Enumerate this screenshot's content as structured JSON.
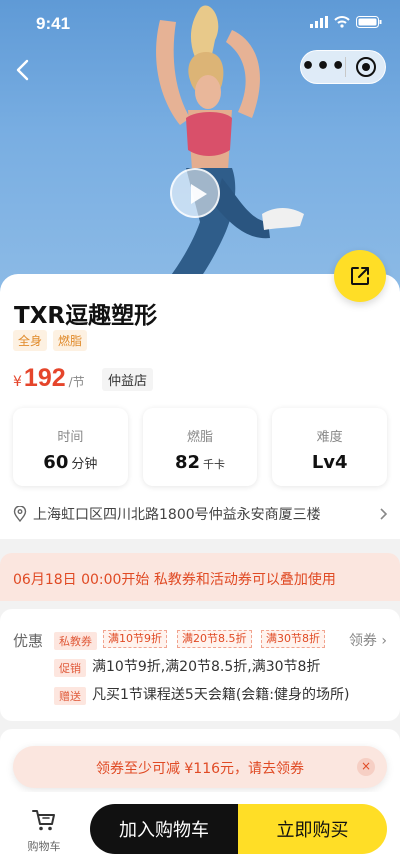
{
  "status_bar": {
    "time": "9:41"
  },
  "product": {
    "title": "TXR逗趣塑形",
    "tags": [
      "全身",
      "燃脂"
    ],
    "price_symbol": "¥",
    "price": "192",
    "price_unit": "/节",
    "store": "仲益店"
  },
  "stats": [
    {
      "label": "时间",
      "value": "60",
      "unit": "分钟"
    },
    {
      "label": "燃脂",
      "value": "82",
      "unit": "千卡"
    },
    {
      "label": "难度",
      "value": "Lv4",
      "unit": ""
    }
  ],
  "address": "上海虹口区四川北路1800号仲益永安商厦三楼",
  "promo_banner": "06月18日 00:00开始 私教券和活动券可以叠加使用",
  "coupons": {
    "label": "优惠",
    "type_tag": "私教券",
    "chips": [
      "满10节9折",
      "满20节8.5折",
      "满30节8折"
    ],
    "get_label": "领券",
    "promo_tag": "促销",
    "promo_text": "满10节9折,满20节8.5折,满30节8折",
    "gift_tag": "赠送",
    "gift_text": "凡买1节课程送5天会籍(会籍:健身的场所)"
  },
  "toast": {
    "message": "领券至少可减 ¥116元，请去领券",
    "close": "×"
  },
  "bottom_bar": {
    "cart_label": "购物车",
    "add_to_cart": "加入购物车",
    "buy_now": "立即购买"
  },
  "colors": {
    "accent_yellow": "#ffde26",
    "price_red": "#e5452b",
    "promo_bg": "#fbe6df"
  }
}
